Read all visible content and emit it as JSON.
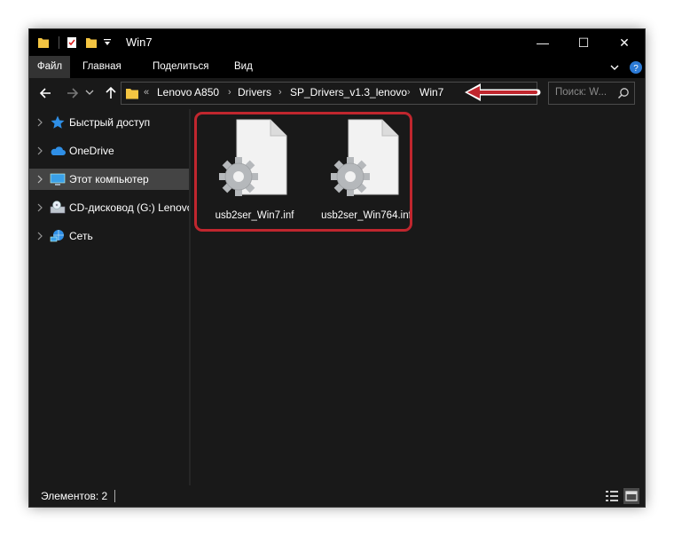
{
  "window": {
    "title": "Win7",
    "minimize_glyph": "—",
    "maximize_glyph": "☐",
    "close_glyph": "✕"
  },
  "ribbon": {
    "tabs": [
      {
        "label": "Файл"
      },
      {
        "label": "Главная"
      },
      {
        "label": "Поделиться"
      },
      {
        "label": "Вид"
      }
    ]
  },
  "address": {
    "overflow": "«",
    "crumbs": [
      {
        "label": "Lenovo A850"
      },
      {
        "label": "Drivers"
      },
      {
        "label": "SP_Drivers_v1.3_lenovo"
      },
      {
        "label": "Win7"
      }
    ],
    "separator": "›"
  },
  "search": {
    "placeholder": "Поиск: W..."
  },
  "sidebar": {
    "items": [
      {
        "label": "Быстрый доступ",
        "icon": "star-icon"
      },
      {
        "label": "OneDrive",
        "icon": "cloud-icon"
      },
      {
        "label": "Этот компьютер",
        "icon": "computer-icon",
        "selected": true
      },
      {
        "label": "CD-дисковод (G:) Lenovo",
        "icon": "cd-drive-icon"
      },
      {
        "label": "Сеть",
        "icon": "network-icon"
      }
    ]
  },
  "files": [
    {
      "name": "usb2ser_Win7.inf",
      "icon": "inf-file-icon"
    },
    {
      "name": "usb2ser_Win764.inf",
      "icon": "inf-file-icon"
    }
  ],
  "status": {
    "items_text": "Элементов: 2"
  },
  "colors": {
    "window_bg": "#191919",
    "titlebar_bg": "#000000",
    "selection": "#444444",
    "highlight_red": "#c0262e",
    "folder_yellow": "#f4c542"
  }
}
